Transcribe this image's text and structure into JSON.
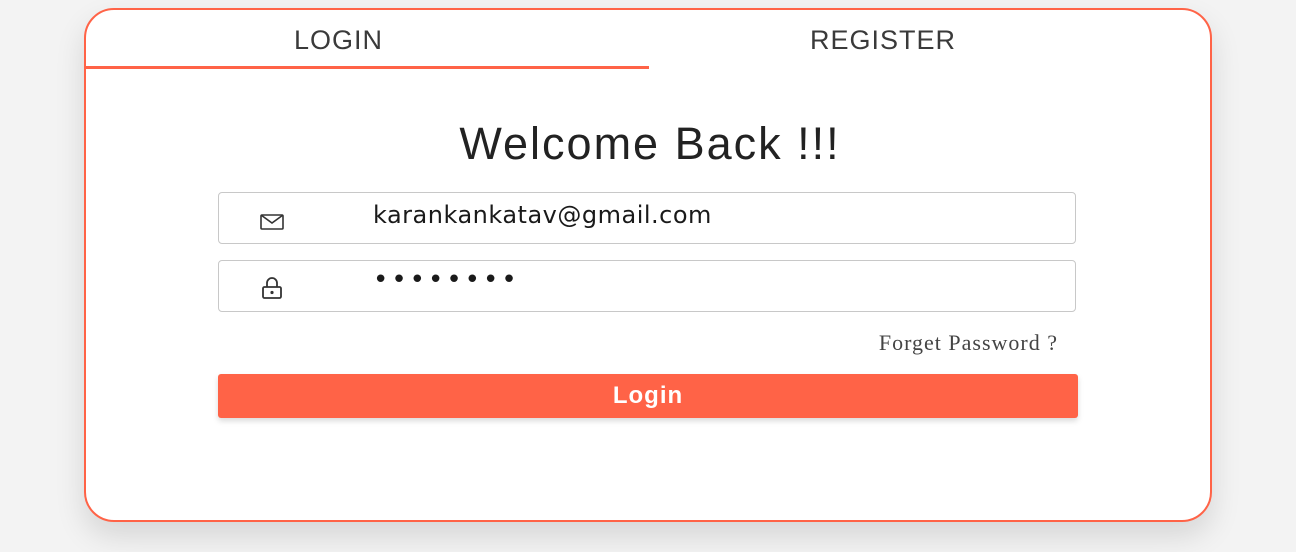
{
  "tabs": {
    "login_label": "LOGIN",
    "register_label": "REGISTER",
    "active": "LOGIN"
  },
  "heading": "Welcome Back !!!",
  "email_field": {
    "value": "karankankatav@gmail.com",
    "icon": "mail-icon"
  },
  "password_field": {
    "value": "••••••••",
    "icon": "lock-icon"
  },
  "forget_link": "Forget Password ?",
  "login_button": "Login",
  "colors": {
    "accent": "#ff6347",
    "background": "#f3f3f3",
    "card": "#ffffff"
  }
}
